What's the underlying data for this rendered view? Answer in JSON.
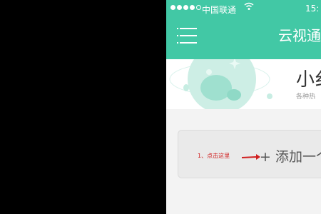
{
  "status_bar": {
    "carrier": "中国联通",
    "time": "15:"
  },
  "header": {
    "title": "云视通"
  },
  "banner": {
    "title": "小纟",
    "subtitle": "各种热"
  },
  "add_device": {
    "annotation": "1、点击这里",
    "label": "+ 添加一个"
  },
  "colors": {
    "brand": "#42c8a5",
    "annotation": "#d02020"
  }
}
